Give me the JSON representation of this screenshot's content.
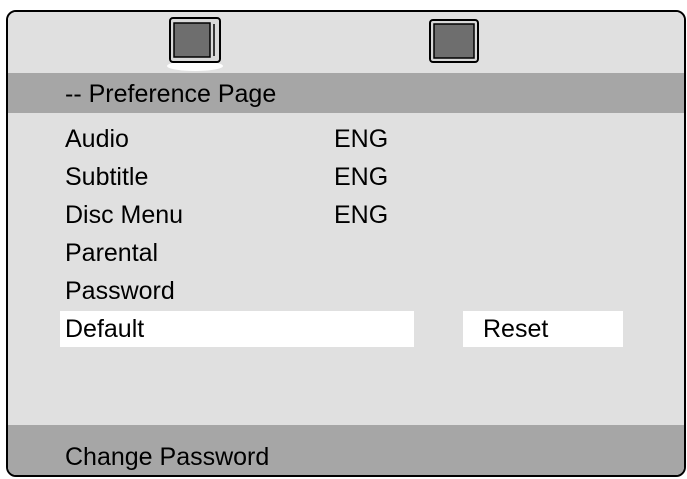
{
  "tabs": [
    {
      "icon": "tv-icon",
      "active": true
    },
    {
      "icon": "screen-square-icon",
      "active": false
    }
  ],
  "header": {
    "title": "-- Preference Page"
  },
  "menu": {
    "items": [
      {
        "label": "Audio",
        "value": "ENG"
      },
      {
        "label": "Subtitle",
        "value": "ENG"
      },
      {
        "label": "Disc Menu",
        "value": "ENG"
      },
      {
        "label": "Parental",
        "value": ""
      },
      {
        "label": "Password",
        "value": ""
      },
      {
        "label": "Default",
        "value": "",
        "selected": true
      }
    ],
    "selected_option": "Reset"
  },
  "footer": {
    "hint": "Change Password"
  },
  "colors": {
    "panel": "#e0e0e0",
    "bar": "#a6a6a6",
    "highlight": "#ffffff",
    "icon_fill": "#6e6e6e"
  }
}
